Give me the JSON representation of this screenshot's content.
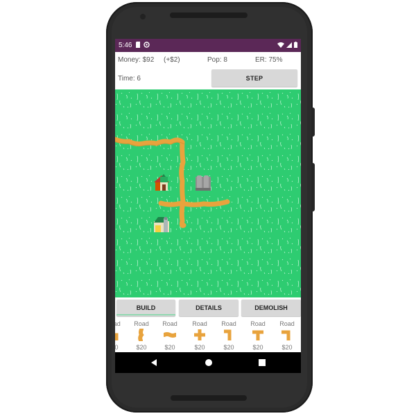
{
  "status_bar": {
    "time": "5:46",
    "left_icons": [
      "sd-card-icon",
      "sync-icon"
    ],
    "right_icons": [
      "wifi-icon",
      "signal-icon",
      "battery-icon"
    ]
  },
  "info": {
    "money": "Money: $92",
    "delta": "(+$2)",
    "pop": "Pop: 8",
    "er": "ER: 75%"
  },
  "time_row": {
    "time": "Time: 6",
    "step_label": "STEP"
  },
  "tabs": [
    {
      "label": "BUILD",
      "selected": true
    },
    {
      "label": "DETAILS",
      "selected": false
    },
    {
      "label": "DEMOLISH",
      "selected": false
    }
  ],
  "palette": [
    {
      "name": "Road",
      "price": "$20",
      "icon": "road-tile-icon"
    },
    {
      "name": "Road",
      "price": "$20",
      "icon": "road-tile-icon"
    },
    {
      "name": "Road",
      "price": "$20",
      "icon": "road-tile-icon"
    },
    {
      "name": "Road",
      "price": "$20",
      "icon": "road-tile-icon"
    },
    {
      "name": "Road",
      "price": "$20",
      "icon": "road-tile-icon"
    },
    {
      "name": "Road",
      "price": "$20",
      "icon": "road-tile-icon"
    },
    {
      "name": "Road",
      "price": "$20",
      "icon": "road-tile-icon"
    }
  ],
  "map": {
    "grass_color": "#2ecc71",
    "road_color": "#e8a33d",
    "buildings": [
      "house-icon",
      "factory-icon",
      "shop-icon"
    ]
  },
  "nav": [
    "back-icon",
    "home-icon",
    "recents-icon"
  ]
}
